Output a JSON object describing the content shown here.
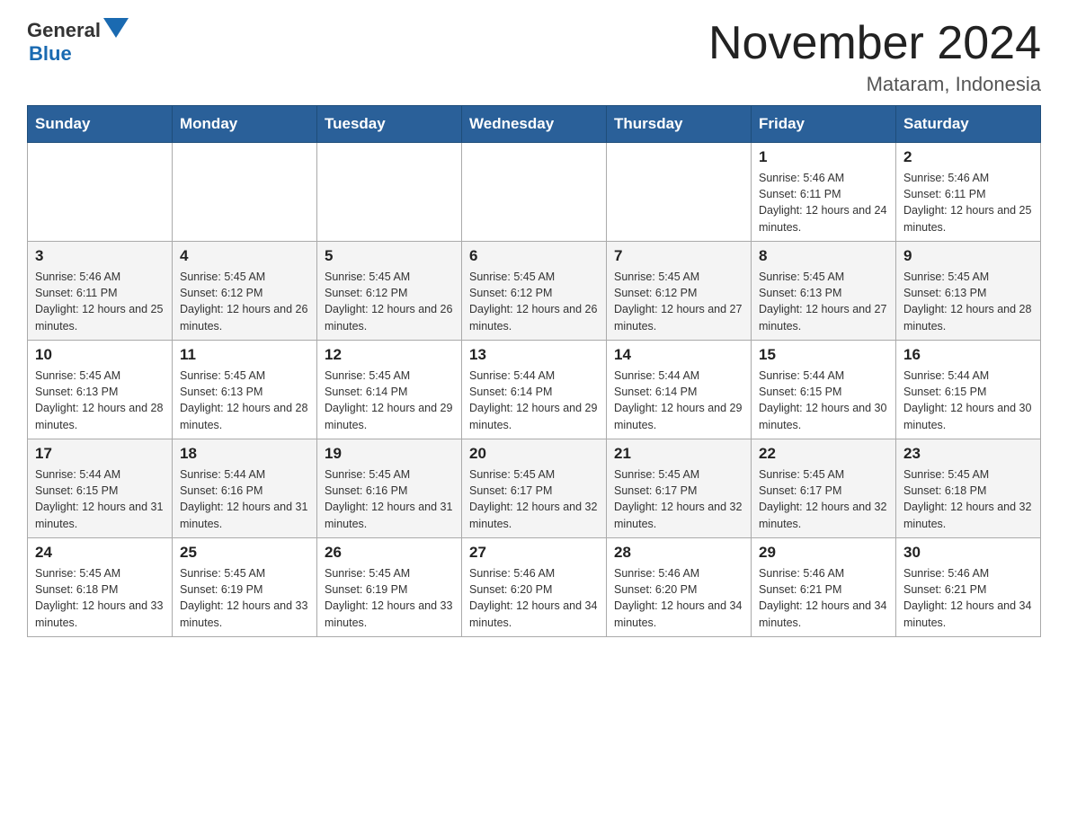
{
  "header": {
    "logo_general": "General",
    "logo_blue": "Blue",
    "month_title": "November 2024",
    "location": "Mataram, Indonesia"
  },
  "days_of_week": [
    "Sunday",
    "Monday",
    "Tuesday",
    "Wednesday",
    "Thursday",
    "Friday",
    "Saturday"
  ],
  "weeks": [
    {
      "cells": [
        {
          "day": "",
          "sunrise": "",
          "sunset": "",
          "daylight": ""
        },
        {
          "day": "",
          "sunrise": "",
          "sunset": "",
          "daylight": ""
        },
        {
          "day": "",
          "sunrise": "",
          "sunset": "",
          "daylight": ""
        },
        {
          "day": "",
          "sunrise": "",
          "sunset": "",
          "daylight": ""
        },
        {
          "day": "",
          "sunrise": "",
          "sunset": "",
          "daylight": ""
        },
        {
          "day": "1",
          "sunrise": "Sunrise: 5:46 AM",
          "sunset": "Sunset: 6:11 PM",
          "daylight": "Daylight: 12 hours and 24 minutes."
        },
        {
          "day": "2",
          "sunrise": "Sunrise: 5:46 AM",
          "sunset": "Sunset: 6:11 PM",
          "daylight": "Daylight: 12 hours and 25 minutes."
        }
      ]
    },
    {
      "cells": [
        {
          "day": "3",
          "sunrise": "Sunrise: 5:46 AM",
          "sunset": "Sunset: 6:11 PM",
          "daylight": "Daylight: 12 hours and 25 minutes."
        },
        {
          "day": "4",
          "sunrise": "Sunrise: 5:45 AM",
          "sunset": "Sunset: 6:12 PM",
          "daylight": "Daylight: 12 hours and 26 minutes."
        },
        {
          "day": "5",
          "sunrise": "Sunrise: 5:45 AM",
          "sunset": "Sunset: 6:12 PM",
          "daylight": "Daylight: 12 hours and 26 minutes."
        },
        {
          "day": "6",
          "sunrise": "Sunrise: 5:45 AM",
          "sunset": "Sunset: 6:12 PM",
          "daylight": "Daylight: 12 hours and 26 minutes."
        },
        {
          "day": "7",
          "sunrise": "Sunrise: 5:45 AM",
          "sunset": "Sunset: 6:12 PM",
          "daylight": "Daylight: 12 hours and 27 minutes."
        },
        {
          "day": "8",
          "sunrise": "Sunrise: 5:45 AM",
          "sunset": "Sunset: 6:13 PM",
          "daylight": "Daylight: 12 hours and 27 minutes."
        },
        {
          "day": "9",
          "sunrise": "Sunrise: 5:45 AM",
          "sunset": "Sunset: 6:13 PM",
          "daylight": "Daylight: 12 hours and 28 minutes."
        }
      ]
    },
    {
      "cells": [
        {
          "day": "10",
          "sunrise": "Sunrise: 5:45 AM",
          "sunset": "Sunset: 6:13 PM",
          "daylight": "Daylight: 12 hours and 28 minutes."
        },
        {
          "day": "11",
          "sunrise": "Sunrise: 5:45 AM",
          "sunset": "Sunset: 6:13 PM",
          "daylight": "Daylight: 12 hours and 28 minutes."
        },
        {
          "day": "12",
          "sunrise": "Sunrise: 5:45 AM",
          "sunset": "Sunset: 6:14 PM",
          "daylight": "Daylight: 12 hours and 29 minutes."
        },
        {
          "day": "13",
          "sunrise": "Sunrise: 5:44 AM",
          "sunset": "Sunset: 6:14 PM",
          "daylight": "Daylight: 12 hours and 29 minutes."
        },
        {
          "day": "14",
          "sunrise": "Sunrise: 5:44 AM",
          "sunset": "Sunset: 6:14 PM",
          "daylight": "Daylight: 12 hours and 29 minutes."
        },
        {
          "day": "15",
          "sunrise": "Sunrise: 5:44 AM",
          "sunset": "Sunset: 6:15 PM",
          "daylight": "Daylight: 12 hours and 30 minutes."
        },
        {
          "day": "16",
          "sunrise": "Sunrise: 5:44 AM",
          "sunset": "Sunset: 6:15 PM",
          "daylight": "Daylight: 12 hours and 30 minutes."
        }
      ]
    },
    {
      "cells": [
        {
          "day": "17",
          "sunrise": "Sunrise: 5:44 AM",
          "sunset": "Sunset: 6:15 PM",
          "daylight": "Daylight: 12 hours and 31 minutes."
        },
        {
          "day": "18",
          "sunrise": "Sunrise: 5:44 AM",
          "sunset": "Sunset: 6:16 PM",
          "daylight": "Daylight: 12 hours and 31 minutes."
        },
        {
          "day": "19",
          "sunrise": "Sunrise: 5:45 AM",
          "sunset": "Sunset: 6:16 PM",
          "daylight": "Daylight: 12 hours and 31 minutes."
        },
        {
          "day": "20",
          "sunrise": "Sunrise: 5:45 AM",
          "sunset": "Sunset: 6:17 PM",
          "daylight": "Daylight: 12 hours and 32 minutes."
        },
        {
          "day": "21",
          "sunrise": "Sunrise: 5:45 AM",
          "sunset": "Sunset: 6:17 PM",
          "daylight": "Daylight: 12 hours and 32 minutes."
        },
        {
          "day": "22",
          "sunrise": "Sunrise: 5:45 AM",
          "sunset": "Sunset: 6:17 PM",
          "daylight": "Daylight: 12 hours and 32 minutes."
        },
        {
          "day": "23",
          "sunrise": "Sunrise: 5:45 AM",
          "sunset": "Sunset: 6:18 PM",
          "daylight": "Daylight: 12 hours and 32 minutes."
        }
      ]
    },
    {
      "cells": [
        {
          "day": "24",
          "sunrise": "Sunrise: 5:45 AM",
          "sunset": "Sunset: 6:18 PM",
          "daylight": "Daylight: 12 hours and 33 minutes."
        },
        {
          "day": "25",
          "sunrise": "Sunrise: 5:45 AM",
          "sunset": "Sunset: 6:19 PM",
          "daylight": "Daylight: 12 hours and 33 minutes."
        },
        {
          "day": "26",
          "sunrise": "Sunrise: 5:45 AM",
          "sunset": "Sunset: 6:19 PM",
          "daylight": "Daylight: 12 hours and 33 minutes."
        },
        {
          "day": "27",
          "sunrise": "Sunrise: 5:46 AM",
          "sunset": "Sunset: 6:20 PM",
          "daylight": "Daylight: 12 hours and 34 minutes."
        },
        {
          "day": "28",
          "sunrise": "Sunrise: 5:46 AM",
          "sunset": "Sunset: 6:20 PM",
          "daylight": "Daylight: 12 hours and 34 minutes."
        },
        {
          "day": "29",
          "sunrise": "Sunrise: 5:46 AM",
          "sunset": "Sunset: 6:21 PM",
          "daylight": "Daylight: 12 hours and 34 minutes."
        },
        {
          "day": "30",
          "sunrise": "Sunrise: 5:46 AM",
          "sunset": "Sunset: 6:21 PM",
          "daylight": "Daylight: 12 hours and 34 minutes."
        }
      ]
    }
  ]
}
